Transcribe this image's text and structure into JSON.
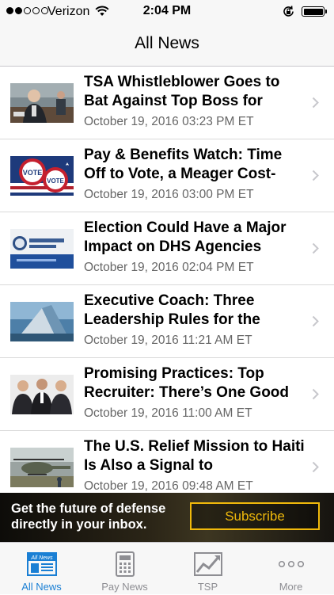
{
  "status_bar": {
    "carrier": "Verizon",
    "time": "2:04 PM",
    "signal_bars": 2
  },
  "nav": {
    "title": "All News"
  },
  "news": [
    {
      "headline": "TSA Whistleblower Goes to Bat Against Top Boss for",
      "date": "October 19, 2016 03:23 PM ET",
      "thumb_icon": "congress-hearing-photo"
    },
    {
      "headline": "Pay & Benefits Watch: Time Off to Vote, a Meager Cost-",
      "date": "October 19, 2016 03:00 PM ET",
      "thumb_icon": "vote-buttons-photo"
    },
    {
      "headline": "Election Could Have a Major Impact on DHS Agencies",
      "date": "October 19, 2016 02:04 PM ET",
      "thumb_icon": "homeland-security-photo"
    },
    {
      "headline": "Executive Coach: Three Leadership Rules for the",
      "date": "October 19, 2016 11:21 AM ET",
      "thumb_icon": "leadership-photo"
    },
    {
      "headline": "Promising Practices: Top Recruiter: There’s One Good",
      "date": "October 19, 2016 11:00 AM ET",
      "thumb_icon": "recruiters-photo"
    },
    {
      "headline": "The U.S. Relief Mission to Haiti Is Also a Signal to",
      "date": "October 19, 2016 09:48 AM ET",
      "thumb_icon": "helicopter-photo"
    }
  ],
  "ad": {
    "text": "Get the future of defense directly in your inbox.",
    "button": "Subscribe",
    "accent_color": "#f0b90b"
  },
  "tabs": [
    {
      "label": "All News",
      "icon": "newspaper-icon",
      "active": true
    },
    {
      "label": "Pay News",
      "icon": "calculator-icon",
      "active": false
    },
    {
      "label": "TSP",
      "icon": "trend-chart-icon",
      "active": false
    },
    {
      "label": "More",
      "icon": "more-dots-icon",
      "active": false
    }
  ],
  "colors": {
    "active_tab": "#1a7fd4",
    "inactive_tab": "#8e8e93"
  }
}
